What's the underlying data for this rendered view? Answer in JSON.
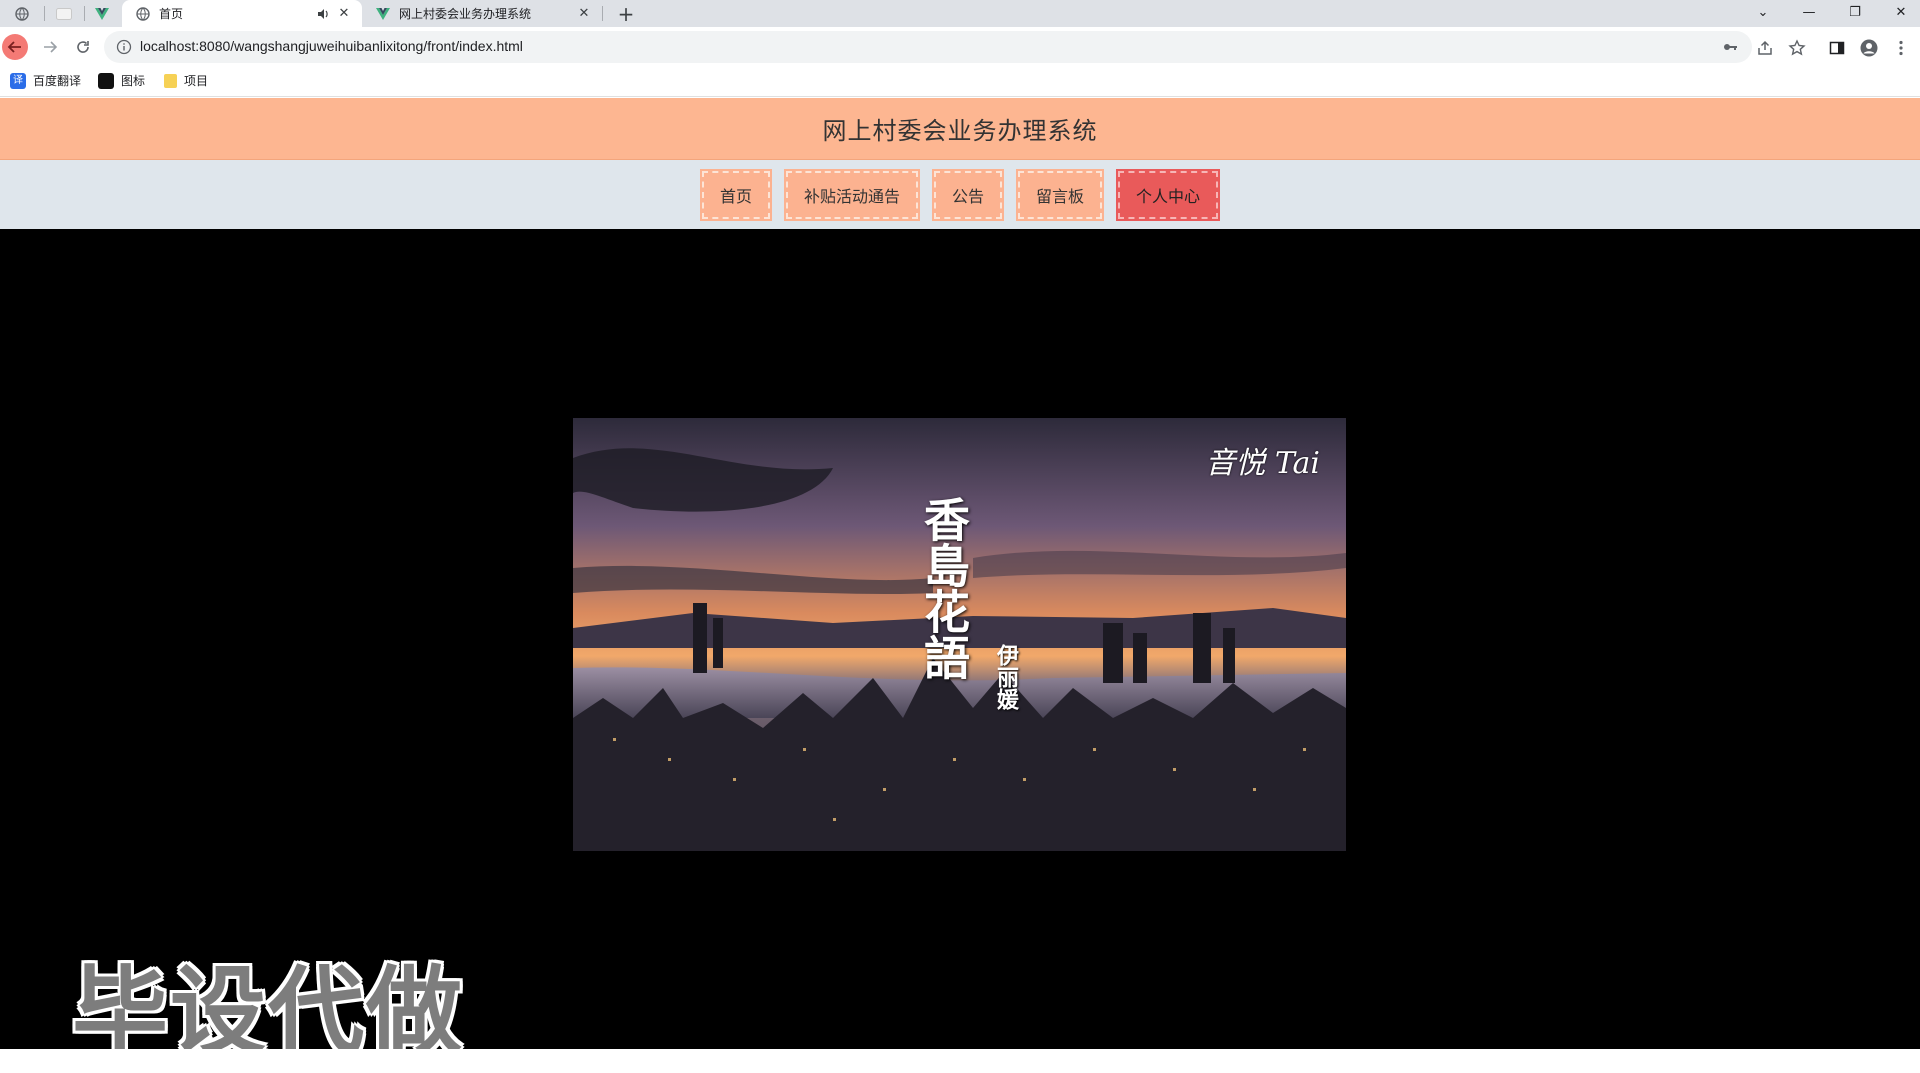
{
  "browser": {
    "tabs": [
      {
        "title": "首页",
        "active": true
      },
      {
        "title": "网上村委会业务办理系统",
        "active": false
      }
    ],
    "new_tab_label": "+",
    "url": "localhost:8080/wangshangjuweihuibanlixitong/front/index.html",
    "bookmarks": [
      {
        "label": "百度翻译",
        "icon": "translate-icon"
      },
      {
        "label": "图标",
        "icon": "image-icon"
      },
      {
        "label": "项目",
        "icon": "folder-icon"
      }
    ]
  },
  "site": {
    "title": "网上村委会业务办理系统",
    "nav": [
      {
        "label": "首页",
        "active": false
      },
      {
        "label": "补贴活动通告",
        "active": false
      },
      {
        "label": "公告",
        "active": false
      },
      {
        "label": "留言板",
        "active": false
      },
      {
        "label": "个人中心",
        "active": true
      }
    ]
  },
  "video": {
    "brand": "音悦 Tai",
    "title": "香島花語",
    "artist": "伊丽媛"
  },
  "watermark": "毕设代做",
  "colors": {
    "header_bg": "#fdb691",
    "nav_bg": "#dfe6ec",
    "nav_item_bg": "#fcb290",
    "nav_active_bg": "#e95a5a"
  }
}
